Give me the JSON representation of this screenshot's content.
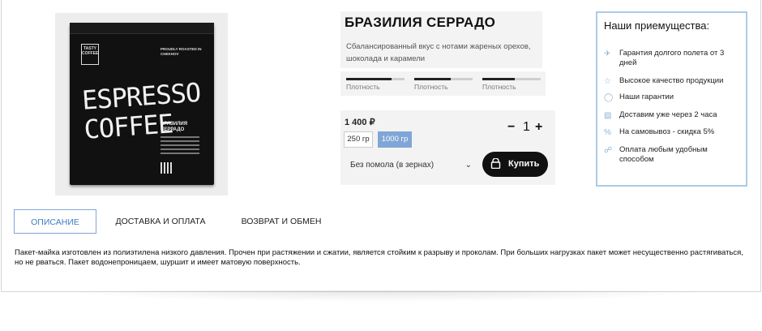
{
  "product": {
    "image": {
      "bag_logo": "TASTY COFFEE",
      "bag_small_text": "PROUDLY ROASTED IN CHEKHOV",
      "bag_title_line1": "ESPRESSO",
      "bag_title_line2": "COFFEE",
      "bag_sub_line1": "БРАЗИЛИЯ",
      "bag_sub_line2": "СЕРРАДО"
    },
    "title": "БРАЗИЛИЯ СЕРРАДО",
    "description": "Сбалансированный вкус с нотами жареных орехов, шоколада и карамели",
    "density": [
      {
        "label": "Плотность",
        "level": 0.78
      },
      {
        "label": "Плотность",
        "level": 0.62
      },
      {
        "label": "Плотность",
        "level": 0.55
      }
    ],
    "price": "1 400 ₽",
    "weights": [
      {
        "label": "250 гр",
        "active": false
      },
      {
        "label": "1000 гр",
        "active": true
      }
    ],
    "grind": "Без помола (в зернах)",
    "quantity": {
      "minus": "−",
      "value": "1",
      "plus": "+"
    },
    "buy_label": "Купить"
  },
  "advantages": {
    "title": "Наши приемущества:",
    "items": [
      {
        "icon": "plane-icon",
        "text": "Гарантия долгого полета от 3 дней"
      },
      {
        "icon": "star-icon",
        "text": "Высокое качество продукции"
      },
      {
        "icon": "shield-icon",
        "text": "Наши гарантии"
      },
      {
        "icon": "truck-icon",
        "text": "Доставим уже через 2 часа"
      },
      {
        "icon": "percent-icon",
        "text": "На самовывоз - скидка 5%"
      },
      {
        "icon": "cart-icon",
        "text": "Оплата любым удобным способом"
      }
    ]
  },
  "tabs": [
    {
      "label": "ОПИСАНИЕ",
      "active": true
    },
    {
      "label": "ДОСТАВКА И ОПЛАТА",
      "active": false
    },
    {
      "label": "ВОЗВРАТ И ОБМЕН",
      "active": false
    }
  ],
  "tab_content": "Пакет-майка изготовлен из полиэтилена низкого давления. Прочен при растяжении и сжатии, является стойким к разрыву и проколам. При больших нагрузках пакет может несущественно растягиваться, но не рваться. Пакет водонепроницаем, шуршит и имеет матовую поверхность.",
  "colors": {
    "accent": "#7fa6d6",
    "advantages_border": "#a9cbe8",
    "button": "#111111"
  }
}
